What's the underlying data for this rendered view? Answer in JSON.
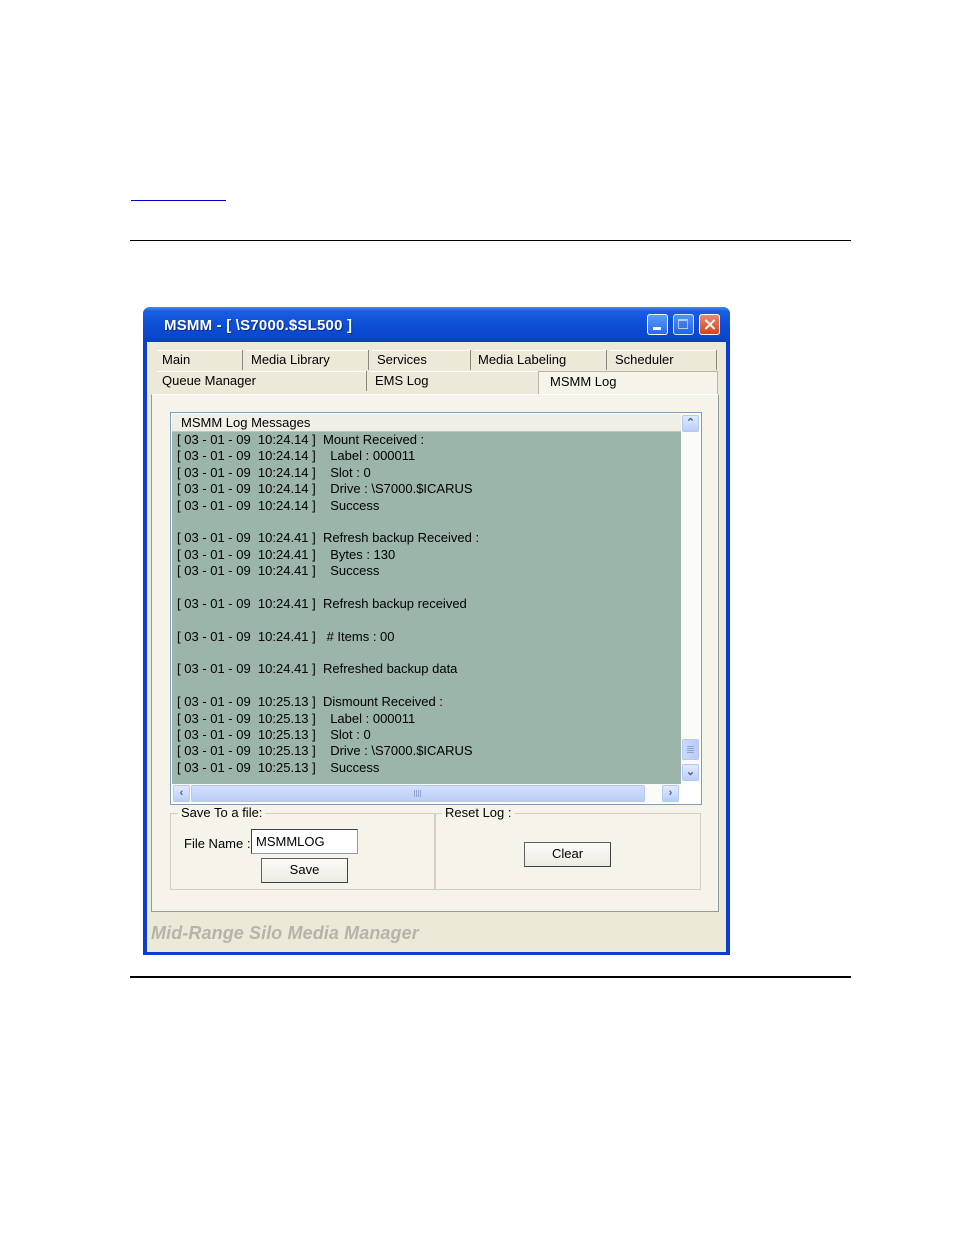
{
  "document": {
    "link_text": ""
  },
  "window": {
    "title": "MSMM - [ \\S7000.$SL500 ]",
    "controls": {
      "minimize": "minimize",
      "maximize": "maximize",
      "close": "close"
    }
  },
  "tabs": {
    "row1": [
      "Main",
      "Media Library",
      "Services",
      "Media Labeling",
      "Scheduler"
    ],
    "row2": [
      "Queue Manager",
      "EMS Log",
      "MSMM Log"
    ],
    "active": "MSMM Log"
  },
  "log": {
    "header": "MSMM Log Messages",
    "lines": [
      "[ 03 - 01 - 09  10:24.14 ]  Mount Received :",
      "[ 03 - 01 - 09  10:24.14 ]    Label : 000011",
      "[ 03 - 01 - 09  10:24.14 ]    Slot : 0",
      "[ 03 - 01 - 09  10:24.14 ]    Drive : \\S7000.$ICARUS",
      "[ 03 - 01 - 09  10:24.14 ]    Success",
      "",
      "[ 03 - 01 - 09  10:24.41 ]  Refresh backup Received :",
      "[ 03 - 01 - 09  10:24.41 ]    Bytes : 130",
      "[ 03 - 01 - 09  10:24.41 ]    Success",
      "",
      "[ 03 - 01 - 09  10:24.41 ]  Refresh backup received",
      "",
      "[ 03 - 01 - 09  10:24.41 ]   # Items : 00",
      "",
      "[ 03 - 01 - 09  10:24.41 ]  Refreshed backup data",
      "",
      "[ 03 - 01 - 09  10:25.13 ]  Dismount Received :",
      "[ 03 - 01 - 09  10:25.13 ]    Label : 000011",
      "[ 03 - 01 - 09  10:25.13 ]    Slot : 0",
      "[ 03 - 01 - 09  10:25.13 ]    Drive : \\S7000.$ICARUS",
      "[ 03 - 01 - 09  10:25.13 ]    Success"
    ],
    "vertical_scroll_position": "bottom"
  },
  "save_group": {
    "title": "Save To a file:",
    "file_name_label": "File Name :",
    "file_name_value": "MSMMLOG",
    "save_button": "Save"
  },
  "reset_group": {
    "title": "Reset Log :",
    "clear_button": "Clear"
  },
  "footer": {
    "brand": "Mid-Range Silo Media Manager"
  },
  "colors": {
    "titlebar": "#0a47cc",
    "log_background": "#9bb5ab",
    "dialog_background": "#ece9d8",
    "link": "#0000cc"
  }
}
